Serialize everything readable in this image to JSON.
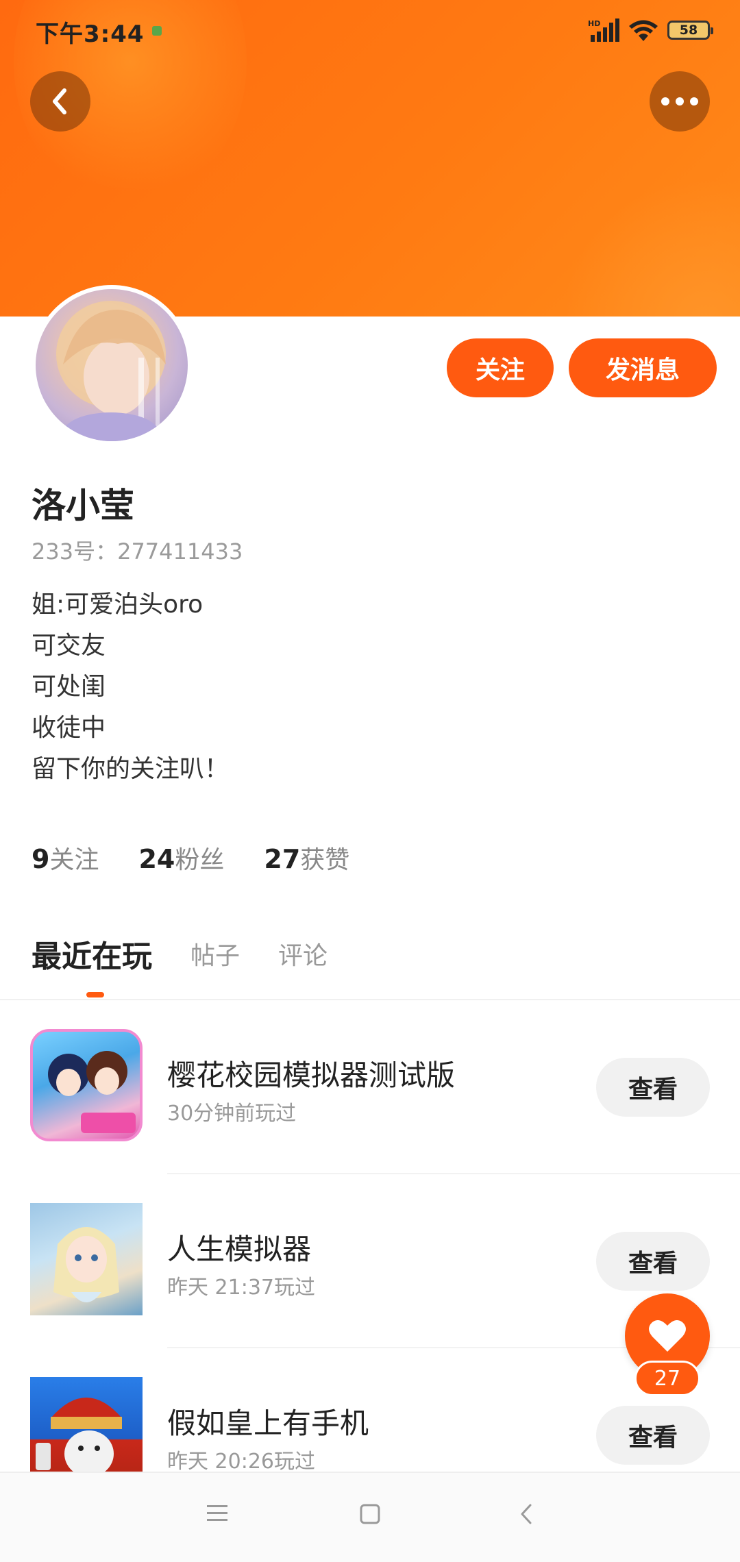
{
  "status_bar": {
    "time": "下午3:44",
    "battery": "58",
    "signal_label": "HD"
  },
  "header": {
    "back_icon": "chevron-left-icon",
    "more_icon": "more-dots-icon",
    "accent_color": "#ff6a10"
  },
  "profile": {
    "name": "洛小莹",
    "uid": "233号：277411433",
    "bio": [
      "姐:可爱泊头oro",
      "可交友",
      "可处闺",
      "收徒中",
      "留下你的关注叭！"
    ],
    "follow_button": "关注",
    "message_button": "发消息"
  },
  "stats": [
    {
      "num": "9",
      "label": "关注"
    },
    {
      "num": "24",
      "label": "粉丝"
    },
    {
      "num": "27",
      "label": "获赞"
    }
  ],
  "tabs": [
    {
      "label": "最近在玩",
      "active": true
    },
    {
      "label": "帖子",
      "active": false
    },
    {
      "label": "评论",
      "active": false
    }
  ],
  "games": [
    {
      "title": "樱花校园模拟器测试版",
      "sub": "30分钟前玩过",
      "button": "查看"
    },
    {
      "title": "人生模拟器",
      "sub": "昨天 21:37玩过",
      "button": "查看"
    },
    {
      "title": "假如皇上有手机",
      "sub": "昨天 20:26玩过",
      "button": "查看"
    }
  ],
  "like_fab": {
    "icon": "heart-icon",
    "count": "27"
  },
  "navbar": {
    "icons": [
      "menu-icon",
      "home-square-icon",
      "back-triangle-icon"
    ]
  }
}
